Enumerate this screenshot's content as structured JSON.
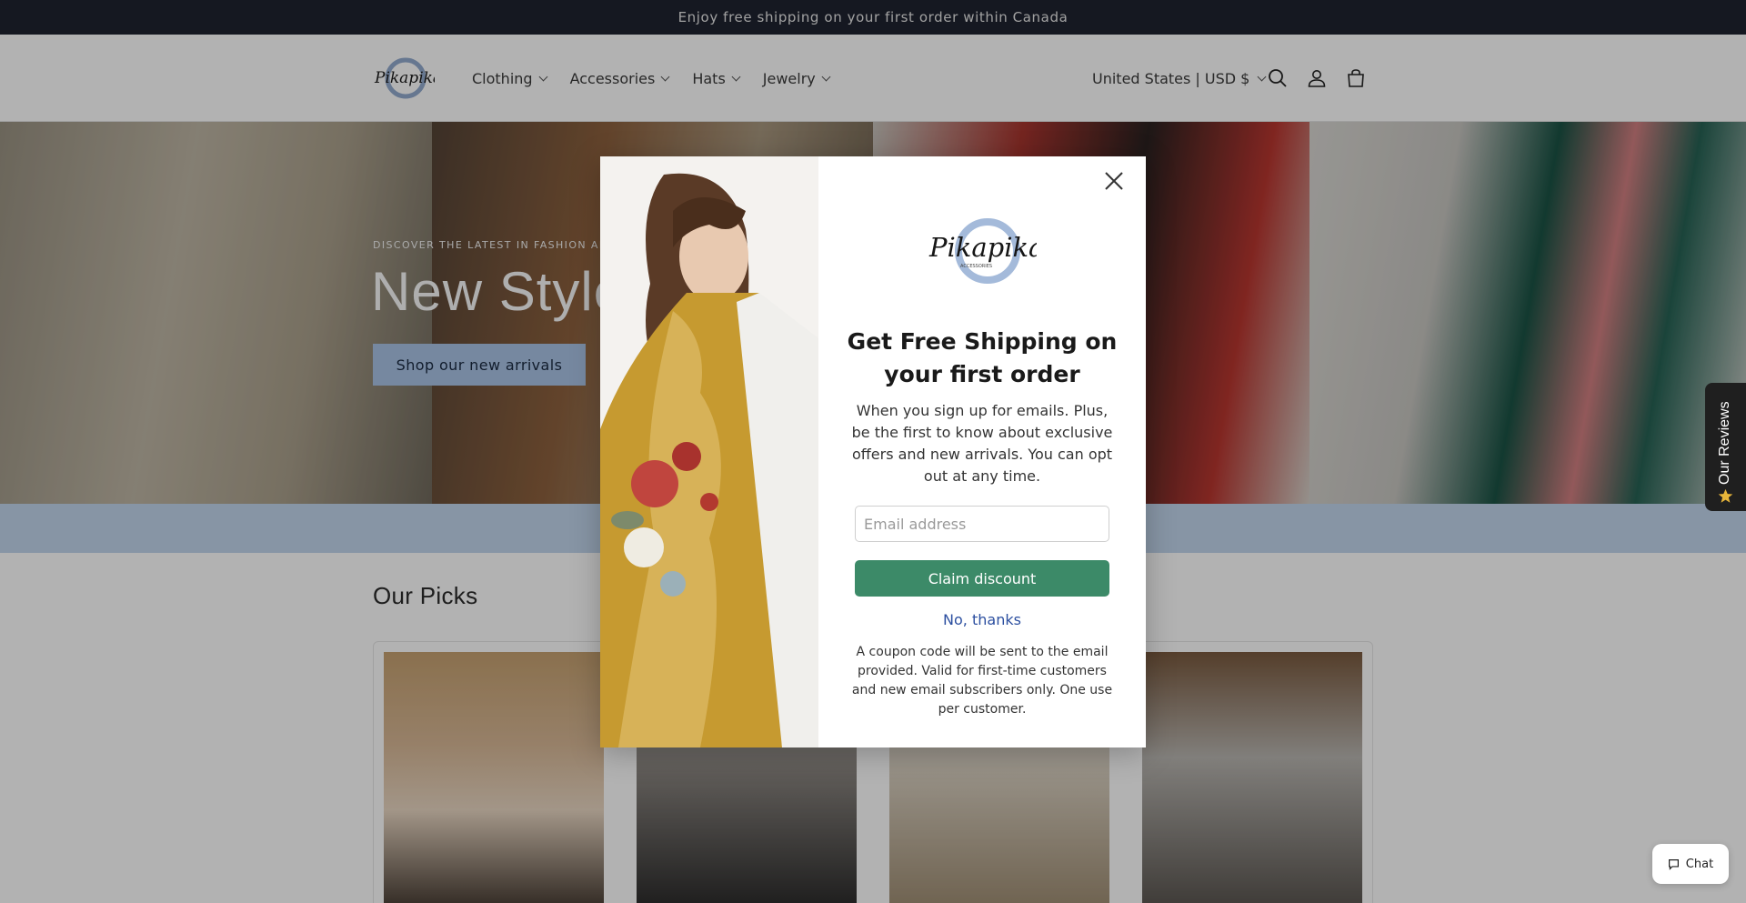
{
  "announcement": "Enjoy free shipping on your first order within Canada",
  "nav": {
    "items": [
      {
        "label": "Clothing"
      },
      {
        "label": "Accessories"
      },
      {
        "label": "Hats"
      },
      {
        "label": "Jewelry"
      }
    ],
    "locale": "United States | USD $"
  },
  "hero": {
    "subtitle": "DISCOVER THE LATEST IN FASHION AND ACCESSORIES",
    "title": "New Styles",
    "button": "Shop our new arrivals"
  },
  "picks": {
    "title": "Our Picks"
  },
  "modal": {
    "logo_text": "Pikapika",
    "logo_subtext": "ACCESSORIES",
    "title": "Get Free Shipping on your first order",
    "text": "When you sign up for emails. Plus, be the first to know about exclusive offers and new arrivals. You can opt out at any time.",
    "email_placeholder": "Email address",
    "claim_button": "Claim discount",
    "decline_link": "No, thanks",
    "fine_print": "A coupon code will be sent to the email provided. Valid for first-time customers and new email subscribers only. One use per customer."
  },
  "reviews_tab": "Our Reviews",
  "chat": "Chat",
  "icons": {
    "search": "search-icon",
    "account": "account-icon",
    "cart": "cart-icon",
    "close": "close-icon",
    "star": "star-icon",
    "chat": "chat-bubble-icon"
  },
  "colors": {
    "announcement_bg": "#1f2330",
    "hero_button": "#a9c3e6",
    "claim_button": "#3c8a68",
    "link": "#2c4fa0"
  }
}
